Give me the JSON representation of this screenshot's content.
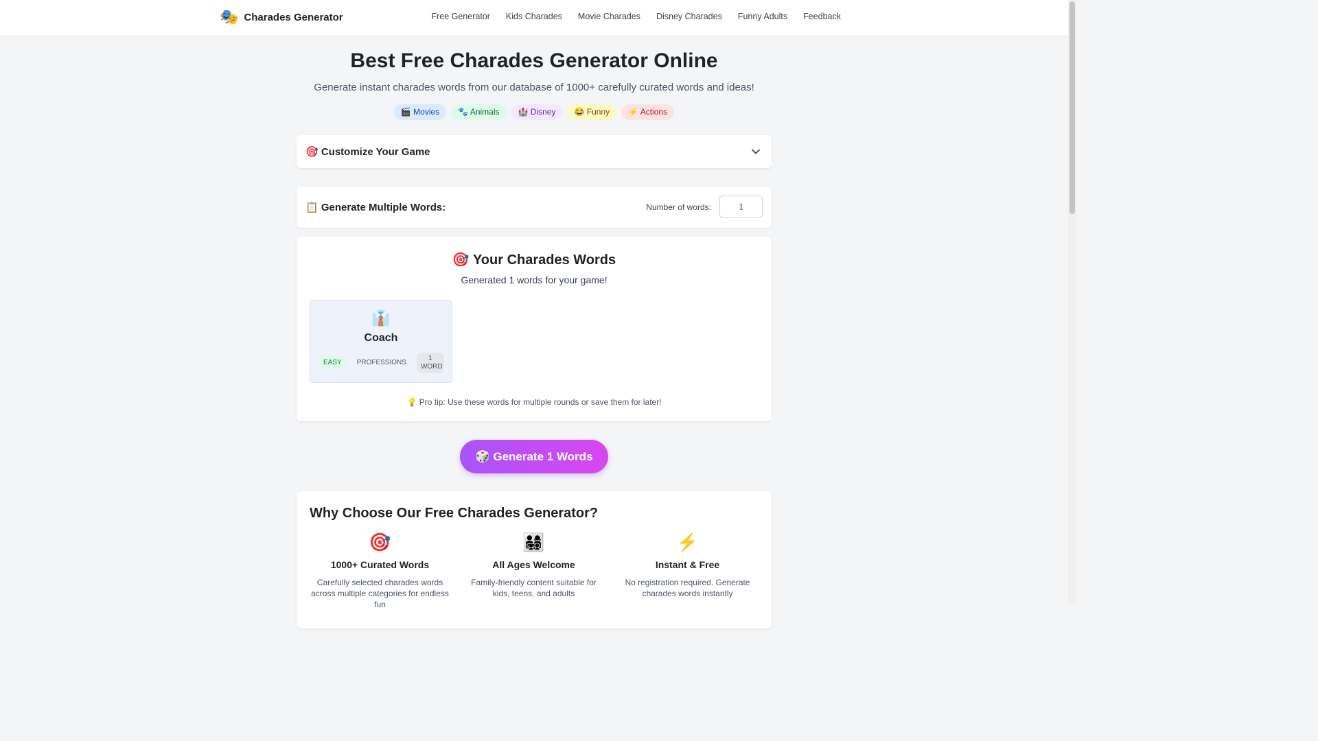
{
  "header": {
    "logo_icon": "🎭",
    "brand": "Charades Generator",
    "nav": [
      "Free Generator",
      "Kids Charades",
      "Movie Charades",
      "Disney Charades",
      "Funny Adults",
      "Feedback"
    ]
  },
  "hero": {
    "title": "Best Free Charades Generator Online",
    "subtitle": "Generate instant charades words from our database of 1000+ carefully curated words and ideas!",
    "chips": [
      "🎬 Movies",
      "🐾 Animals",
      "🏰 Disney",
      "😂 Funny",
      "⚡ Actions"
    ]
  },
  "customize": {
    "title": "🎯 Customize Your Game"
  },
  "multi": {
    "title": "📋 Generate Multiple Words:",
    "label": "Number of words:",
    "value": "1"
  },
  "results": {
    "title": "🎯 Your Charades Words",
    "subtitle": "Generated 1 words for your game!",
    "card": {
      "emoji": "👔",
      "word": "Coach",
      "difficulty": "EASY",
      "category": "PROFESSIONS",
      "word_count": "1 WORD"
    },
    "tip": "💡 Pro tip: Use these words for multiple rounds or save them for later!"
  },
  "generate_button": {
    "label": "🎲 Generate 1 Words"
  },
  "why": {
    "title": "Why Choose Our Free Charades Generator?",
    "features": [
      {
        "icon": "🎯",
        "title": "1000+ Curated Words",
        "desc": "Carefully selected charades words across multiple categories for endless fun"
      },
      {
        "icon": "👨‍👩‍👧‍👦",
        "title": "All Ages Welcome",
        "desc": "Family-friendly content suitable for kids, teens, and adults"
      },
      {
        "icon": "⚡",
        "title": "Instant & Free",
        "desc": "No registration required. Generate charades words instantly"
      }
    ]
  },
  "colors": {
    "accent_start": "#a855f7",
    "accent_end": "#d946ef"
  }
}
